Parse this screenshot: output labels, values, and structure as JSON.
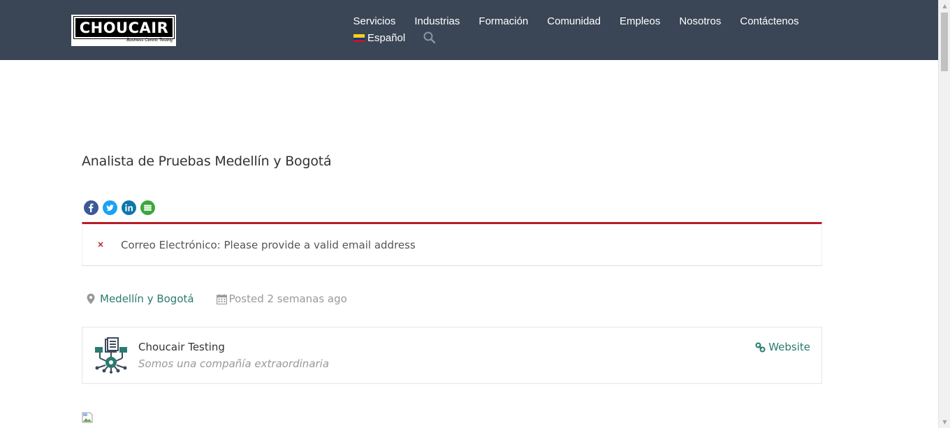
{
  "header": {
    "logo_text": "CHOUCAIR",
    "logo_tagline": "Business Centric Testing",
    "nav": [
      {
        "label": "Servicios"
      },
      {
        "label": "Industrias"
      },
      {
        "label": "Formación"
      },
      {
        "label": "Comunidad"
      },
      {
        "label": "Empleos"
      },
      {
        "label": "Nosotros"
      },
      {
        "label": "Contáctenos"
      }
    ],
    "language": "Español"
  },
  "job": {
    "title": "Analista de Pruebas Medellín y Bogotá",
    "location": "Medellín y Bogotá",
    "posted": "Posted 2 semanas ago"
  },
  "alert": {
    "icon": "×",
    "message": "Correo Electrónico: Please provide a valid email address"
  },
  "company": {
    "name": "Choucair Testing",
    "tagline": "Somos una compañía extraordinaria",
    "website_label": "Website"
  },
  "colors": {
    "header_bg": "#3a4556",
    "accent_teal": "#2a7a6f",
    "alert_red": "#b81c23"
  },
  "icons": {
    "search": "search-icon",
    "share": [
      "facebook-icon",
      "twitter-icon",
      "linkedin-icon",
      "more-share-icon"
    ],
    "location": "map-pin-icon",
    "date": "calendar-icon",
    "website": "link-icon"
  }
}
